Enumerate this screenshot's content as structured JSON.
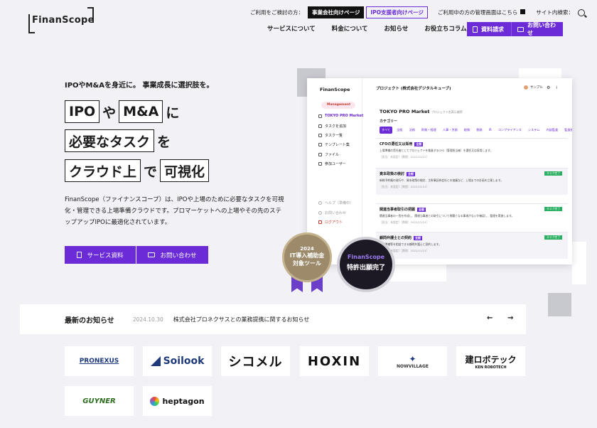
{
  "header": {
    "logo": "FinanScope",
    "utility_label": "ご利用をご検討の方：",
    "for_companies": "事業会社向けページ",
    "for_advisors": "IPO支援者向けページ",
    "management_link": "ご利用中の方の管理画面はこちら",
    "site_search": "サイト内検索：",
    "nav": [
      "サービスについて",
      "料金について",
      "お知らせ",
      "お役立ちコラム"
    ],
    "cta_docs": "資料請求",
    "cta_contact": "お問い合わせ"
  },
  "hero": {
    "lead": "IPOやM&Aを身近に。 事業成長に選択肢を。",
    "w1": "IPO",
    "p1": "や",
    "w2": "M&A",
    "p2": "に",
    "w3": "必要なタスク",
    "p3": "を",
    "w4": "クラウド上",
    "p4": "で",
    "w5": "可視化",
    "description": "FinanScope（ファイナンスコープ）は、IPOや上場のために必要なタスクを可視化・管理できる上場準備クラウドです。プロマーケットへの上場やその先のステップアップIPOに最適化されています。",
    "btn_service_docs": "サービス資料",
    "btn_contact": "お問い合わせ"
  },
  "mockup": {
    "logo": "FinanScope",
    "tag": "Management",
    "sidebar": [
      "TOKYO PRO Market",
      "タスクを追加",
      "タスク一覧",
      "テンプレート集",
      "ファイル",
      "参加ユーザー"
    ],
    "sidebar_bottom": [
      "ヘルプ（準備中）",
      "お問い合わせ",
      "ログアウト"
    ],
    "project": "プロジェクト (株式会社デジタルキューブ)",
    "user": "サンプル",
    "title": "TOKYO PRO Market",
    "subtitle": "プロジェクト名表示順序",
    "category": "カテゴリー",
    "tabs": [
      "すべて",
      "全般",
      "法務",
      "財務・経理",
      "人事・労務",
      "総務",
      "税務",
      "IR",
      "コンプライアンス",
      "システム",
      "内部監査",
      "監査役"
    ],
    "cards": [
      {
        "title": "CFOの選任又は採用",
        "tag": "全般",
        "body": "上場準備の責任者としてプロジェクトを推進するCFO（管理担当者）を選任又は採用します。",
        "meta": "［担当：未設定］［期限：2022/12/21］",
        "status": ""
      },
      {
        "title": "資本政策の検討",
        "tag": "全般",
        "body": "新株予約権の発行や、資本政策の検討、主幹事証券会社との協議など、上場までの計画を立案します。",
        "meta": "［担当：未設定］［期限：2022/12/21］",
        "status": "タスク完了"
      },
      {
        "title": "関連当事者取引の把握",
        "tag": "全般",
        "body": "関連当事者の一覧を作成し、関連当事者との取引について問題となる事項がないか確認し、整理を実施します。",
        "meta": "［担当：未設定］［期限：2022/12/21］",
        "status": "タスク完了"
      },
      {
        "title": "顧問弁護士との契約",
        "tag": "全般",
        "body": "上場準備等を相談できる顧問弁護士と契約します。",
        "meta": "［担当：未設定］［期限：2022/12/21］",
        "status": "タスク完了"
      }
    ]
  },
  "badges": {
    "gold_year": "2024",
    "gold_text1": "IT導入補助金",
    "gold_text2": "対象ツール",
    "black_brand": "FinanScope",
    "black_text": "特許出願完了"
  },
  "news": {
    "heading": "最新のお知らせ",
    "date": "2024.10.30",
    "title": "株式会社プロネクサスとの業務提携に関するお知らせ",
    "prev": "←",
    "next": "→"
  },
  "partners": [
    "PRONEXUS",
    "Soilook",
    "シコメル",
    "HOXIN",
    "NOWVILLAGE",
    "建ロボテック",
    "GUYNER",
    "heptagon"
  ],
  "partner_sub": {
    "robotech": "KEN ROBOTECH",
    "guyner": "GUYNER"
  },
  "colors": {
    "accent": "#6b2bd6",
    "dark": "#111111",
    "bg": "#f1f1f6"
  }
}
